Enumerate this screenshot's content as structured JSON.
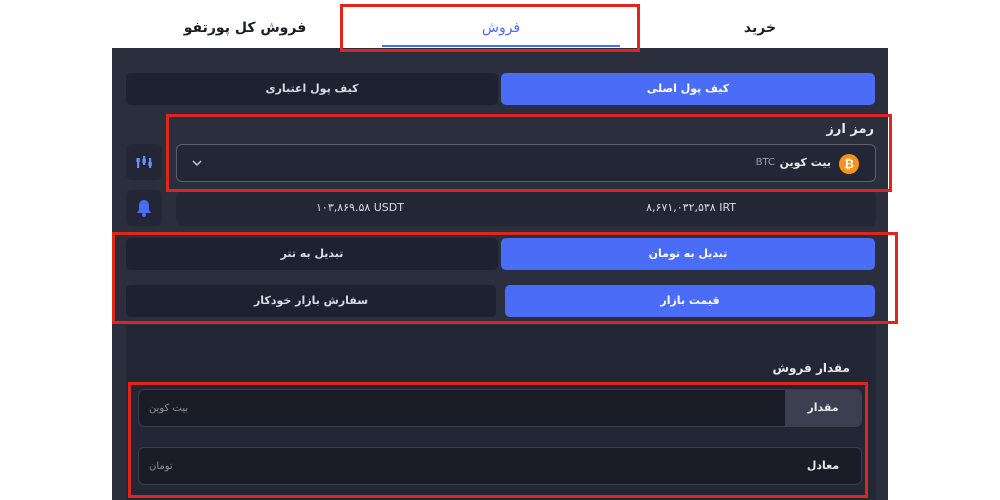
{
  "tabs": {
    "buy": "خرید",
    "sell": "فروش",
    "sell_portfolio": "فروش کل پورتفو"
  },
  "wallet": {
    "main": "کیف پول اصلی",
    "credit": "کیف پول اعتباری"
  },
  "currency": {
    "label": "رمز ارز",
    "coin_name": "بیت کوین",
    "coin_symbol": "BTC",
    "coin_glyph": "₿"
  },
  "balances": {
    "irt": "۸,۶۷۱,۰۳۲,۵۳۸ IRT",
    "usdt": "۱۰۳,۸۶۹.۵۸ USDT"
  },
  "convert": {
    "to_toman": "تبدیل به تومان",
    "to_tether": "تبدیل به تتر"
  },
  "order": {
    "market_price": "قیمت بازار",
    "auto_market": "سفارش بازار خودکار"
  },
  "sell_amount": {
    "label": "مقدار فروش",
    "amount_label": "مقدار",
    "amount_placeholder": "بیت کوین",
    "equivalent_label": "معادل",
    "equivalent_placeholder": "تومان"
  },
  "colors": {
    "accent": "#4a6cf7",
    "highlight": "#e0251c",
    "bitcoin": "#f7931a"
  },
  "icons": [
    "chart-icon",
    "bell-icon",
    "chevron-down-icon",
    "bitcoin-icon"
  ]
}
